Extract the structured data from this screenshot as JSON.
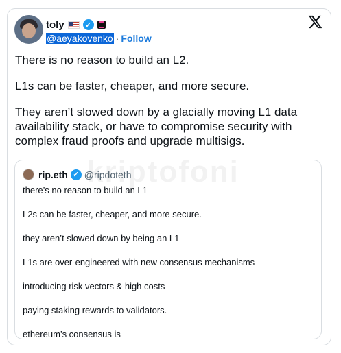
{
  "author": {
    "name": "toly",
    "handle": "@aeyakovenko",
    "separator": "·",
    "follow_label": "Follow"
  },
  "tweet": {
    "paragraphs": [
      "There is no reason to build an L2.",
      "L1s can be faster, cheaper, and more secure.",
      "They aren’t slowed down by a glacially moving L1 data availability stack, or have to compromise security with complex fraud proofs and upgrade multisigs."
    ]
  },
  "quote": {
    "name": "rip.eth",
    "handle": "@ripdoteth",
    "lines": [
      "there’s no reason to build an L1",
      "L2s can be faster, cheaper, and more secure.",
      "they aren’t slowed down by being an L1",
      "L1s are over-engineered with new consensus mechanisms",
      "introducing risk vectors & high costs",
      "paying staking rewards to validators.",
      "ethereum’s consensus is"
    ]
  },
  "watermark": "kriptofoni",
  "icons": {
    "platform": "x-logo-icon",
    "verified": "verified-badge-icon",
    "flag": "us-flag-icon",
    "affiliation": "affiliation-badge-icon"
  },
  "colors": {
    "verified": "#1d9bf0",
    "follow": "#1d7bdc",
    "handle_highlight": "#0b66d8",
    "border": "#d9dde1"
  }
}
